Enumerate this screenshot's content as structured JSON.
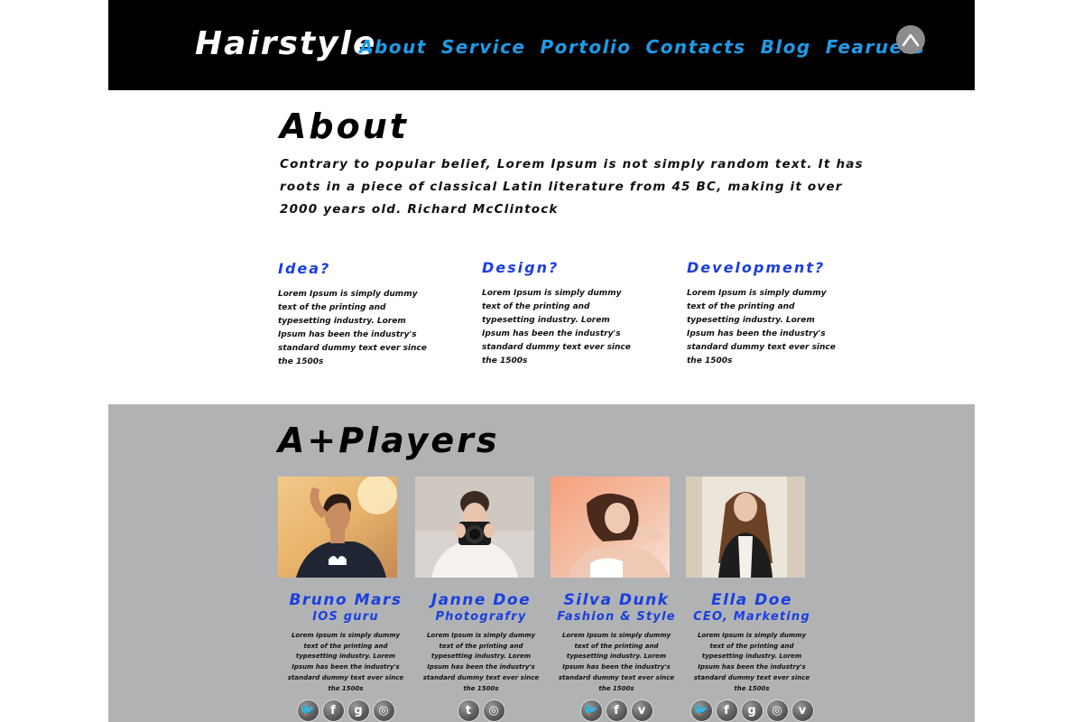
{
  "brand": {
    "logo": "Hairstyle"
  },
  "nav": [
    "About",
    "Service",
    "Portolio",
    "Contacts",
    "Blog",
    "Fearuers"
  ],
  "about": {
    "title": "About",
    "text": "Contrary to popular belief, Lorem Ipsum is not simply random text. It has roots in a piece of classical Latin literature from 45 BC, making it over 2000 years old. Richard McClintock",
    "features": [
      {
        "title": "Idea?",
        "text": "Lorem Ipsum is simply dummy text of the printing and typesetting industry. Lorem Ipsum has been the industry's standard dummy text ever since the 1500s"
      },
      {
        "title": "Design?",
        "text": "Lorem Ipsum is simply dummy text of the printing and typesetting industry. Lorem Ipsum has been the industry's standard dummy text ever since the 1500s"
      },
      {
        "title": "Development?",
        "text": "Lorem Ipsum is simply dummy text of the printing and typesetting industry. Lorem Ipsum has been the industry's standard dummy text ever since the 1500s"
      }
    ]
  },
  "players": {
    "title": "A+Players",
    "members": [
      {
        "name": "Bruno Mars",
        "role": "IOS guru",
        "text": "Lorem Ipsum is simply dummy text of the printing and typesetting industry. Lorem Ipsum has been the industry's standard dummy text ever since the 1500s",
        "socials": [
          "twitter-icon",
          "facebook-icon",
          "google-plus-icon",
          "dribbble-icon"
        ]
      },
      {
        "name": "Janne Doe",
        "role": "Photografry",
        "text": "Lorem Ipsum is simply dummy text of the printing and typesetting industry. Lorem Ipsum has been the industry's standard dummy text ever since the 1500s",
        "socials": [
          "tumblr-icon",
          "dribbble-icon"
        ]
      },
      {
        "name": "Silva Dunk",
        "role": "Fashion & Style",
        "text": "Lorem Ipsum is simply dummy text of the printing and typesetting industry. Lorem Ipsum has been the industry's standard dummy text ever since the 1500s",
        "socials": [
          "twitter-icon",
          "facebook-icon",
          "vimeo-icon"
        ]
      },
      {
        "name": "Ella Doe",
        "role": "CEO, Marketing",
        "text": "Lorem Ipsum is simply dummy text of the printing and typesetting industry. Lorem Ipsum has been the industry's standard dummy text ever since the 1500s",
        "socials": [
          "twitter-icon",
          "facebook-icon",
          "google-plus-icon",
          "dribbble-icon",
          "vimeo-icon"
        ]
      }
    ]
  },
  "colors": {
    "header_bg": "#000000",
    "nav_link": "#1e9be8",
    "accent": "#1a3fe0",
    "players_bg": "#b1b2b4"
  }
}
